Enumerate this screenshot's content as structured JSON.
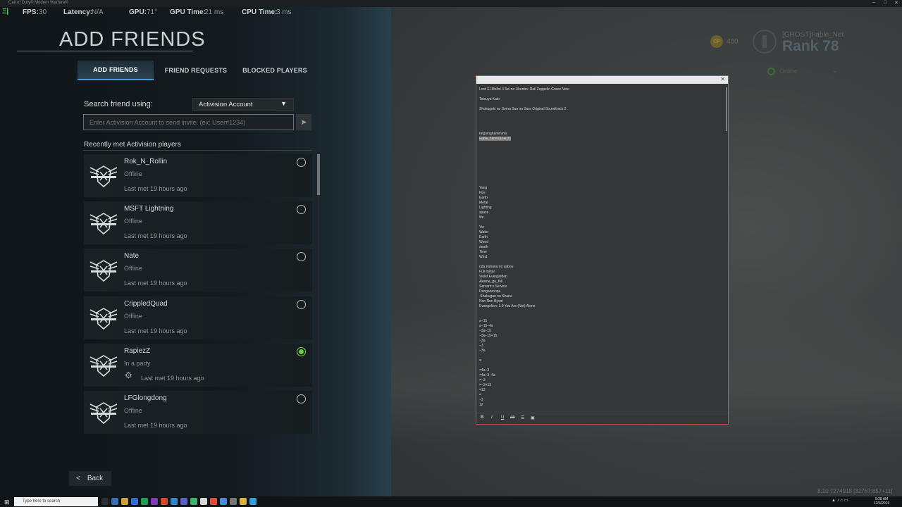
{
  "window": {
    "title": "Call of Duty® Modern Warfare®"
  },
  "perf": {
    "fps_label": "FPS:",
    "fps_value": "30",
    "latency_label": "Latency:",
    "latency_value": "N/A",
    "gpu_label": "GPU:",
    "gpu_value": "71°",
    "gpu_time_label": "GPU Time:",
    "gpu_time_value": "21 ms",
    "cpu_time_label": "CPU Time:",
    "cpu_time_value": "3 ms"
  },
  "page": {
    "title": "ADD FRIENDS"
  },
  "tabs": [
    {
      "label": "ADD FRIENDS",
      "active": true
    },
    {
      "label": "FRIEND REQUESTS",
      "active": false
    },
    {
      "label": "BLOCKED PLAYERS",
      "active": false
    }
  ],
  "search": {
    "label": "Search friend using:",
    "method": "Activision Account",
    "placeholder": "Enter Activision Account to send invite. (ex: User#1234)"
  },
  "recent": {
    "label": "Recently met Activision players",
    "players": [
      {
        "name": "Rok_N_Rollin",
        "status": "Offline",
        "last_met": "Last met 19 hours ago",
        "selected": false,
        "in_party": false
      },
      {
        "name": "MSFT Lightning",
        "status": "Offline",
        "last_met": "Last met 19 hours ago",
        "selected": false,
        "in_party": false
      },
      {
        "name": "Nate",
        "status": "Offline",
        "last_met": "Last met 19 hours ago",
        "selected": false,
        "in_party": false
      },
      {
        "name": "CrippledQuad",
        "status": "Offline",
        "last_met": "Last met 19 hours ago",
        "selected": false,
        "in_party": false
      },
      {
        "name": "RapiezZ",
        "status": "In a party",
        "last_met": "Last met 19 hours ago",
        "selected": true,
        "in_party": true
      },
      {
        "name": "LFGlongdong",
        "status": "Offline",
        "last_met": "Last met 19 hours ago",
        "selected": false,
        "in_party": false
      }
    ]
  },
  "back": {
    "label": "Back"
  },
  "profile": {
    "cp_icon": "CP",
    "cp_value": "400",
    "name": "[GHOST]Fable_Net",
    "rank": "Rank 78",
    "presence": "Online"
  },
  "build": "8.10.7274918 [32787:857+11]",
  "notes": {
    "lines": [
      "Lord El-Melloi II Sei no Jikenbo: Rail Zeppelin Grace Note",
      "",
      "Tatsuya Kato",
      "",
      "Shokugeki no Soma San no Sara Original Soundtrack 2",
      "",
      "",
      "",
      "",
      "Imgoinghammmis",
      "",
      "",
      "",
      "",
      "",
      "",
      "",
      "",
      "",
      "Yang",
      "Fire",
      "Earth",
      "Metal",
      "Lighting",
      "space",
      "life",
      "",
      "Yin",
      "Water",
      "Earth",
      "Wood",
      "death",
      "Time",
      "Wind",
      "",
      "oda nobuna no yabou",
      "Full metal",
      "Violet Evergarden",
      "Akame_ga_Kill",
      "Servant x Service",
      "Danganronpa",
      " Shakugan no Shana",
      "Non Non Biyori",
      "Evangelion: 1.0 You Are (Not) Alone",
      "",
      "",
      "a−15",
      "a−15−4a",
      "−3a−15",
      "−3a−15+15",
      "−3a",
      "−3",
      "−3a",
      "",
      "a",
      "",
      "=4a−3",
      "=4a−3−4a",
      "=−3",
      "=−3+15",
      "=12",
      "=",
      "−3",
      "12"
    ],
    "highlight": "Fable_Net#2934031",
    "toolbar": [
      "B",
      "I",
      "U",
      "ab",
      "☰",
      "▣"
    ]
  },
  "taskbar": {
    "search_placeholder": "Type here to search",
    "time": "9:28 AM",
    "date": "12/4/2019"
  }
}
